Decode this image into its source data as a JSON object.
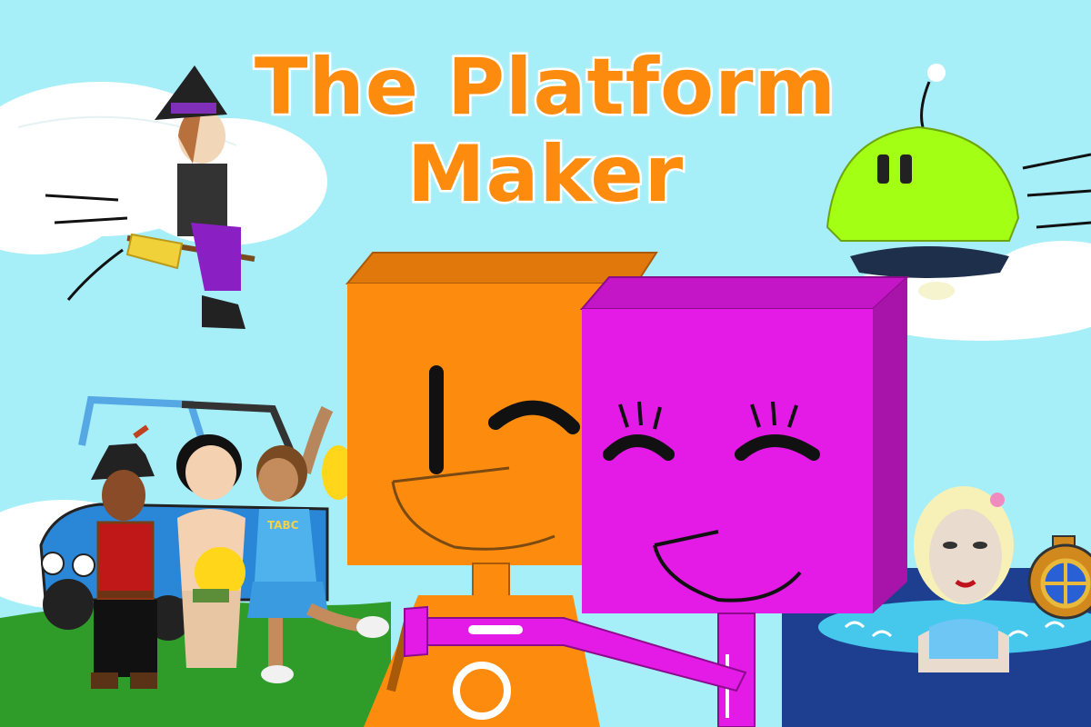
{
  "title": {
    "line1": "The Platform",
    "line2": "Maker"
  },
  "characters": {
    "cheerleader_shirt_text": "TABC"
  },
  "colors": {
    "sky": "#a6eef8",
    "title": "#fd8c0e",
    "orange_box": "#fd8c0e",
    "magenta_box": "#e41ae6",
    "alien_ship": "#a3ff14",
    "grass": "#2f9c2a",
    "water": "#46c8ec"
  }
}
